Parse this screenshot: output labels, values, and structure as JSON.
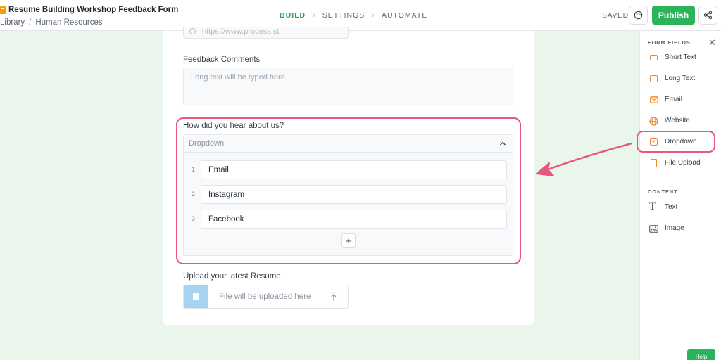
{
  "header": {
    "doc_title": "Resume Building Workshop Feedback Form",
    "breadcrumb": [
      "Library",
      "Human Resources"
    ],
    "steps": [
      "BUILD",
      "SETTINGS",
      "AUTOMATE"
    ],
    "active_step": "BUILD",
    "saved_label": "SAVED",
    "publish_label": "Publish"
  },
  "form": {
    "url_placeholder": "https://www.process.st",
    "feedback_label": "Feedback Comments",
    "feedback_placeholder": "Long text will be typed here",
    "dropdown_question": "How did you hear about us?",
    "dropdown_placeholder": "Dropdown",
    "options": [
      {
        "num": "1",
        "text": "Email"
      },
      {
        "num": "2",
        "text": "Instagram"
      },
      {
        "num": "3",
        "text": "Facebook"
      }
    ],
    "add_option_label": "+",
    "upload_label": "Upload your latest Resume",
    "upload_placeholder": "File will be uploaded here"
  },
  "panel": {
    "form_fields_title": "FORM FIELDS",
    "close_label": "✕",
    "form_fields": [
      {
        "label": "Short Text",
        "icon": "short-text-icon"
      },
      {
        "label": "Long Text",
        "icon": "long-text-icon"
      },
      {
        "label": "Email",
        "icon": "email-icon"
      },
      {
        "label": "Website",
        "icon": "globe-icon"
      },
      {
        "label": "Dropdown",
        "icon": "dropdown-icon"
      },
      {
        "label": "File Upload",
        "icon": "file-upload-icon"
      }
    ],
    "content_title": "CONTENT",
    "content_items": [
      {
        "label": "Text",
        "icon": "text-icon"
      },
      {
        "label": "Image",
        "icon": "image-icon"
      }
    ]
  },
  "help_label": "Help",
  "colors": {
    "accent_green": "#2bb35c",
    "field_icon_orange": "#f08b2d",
    "annotation_pink": "#e8587a",
    "background": "#eaf6ec"
  }
}
